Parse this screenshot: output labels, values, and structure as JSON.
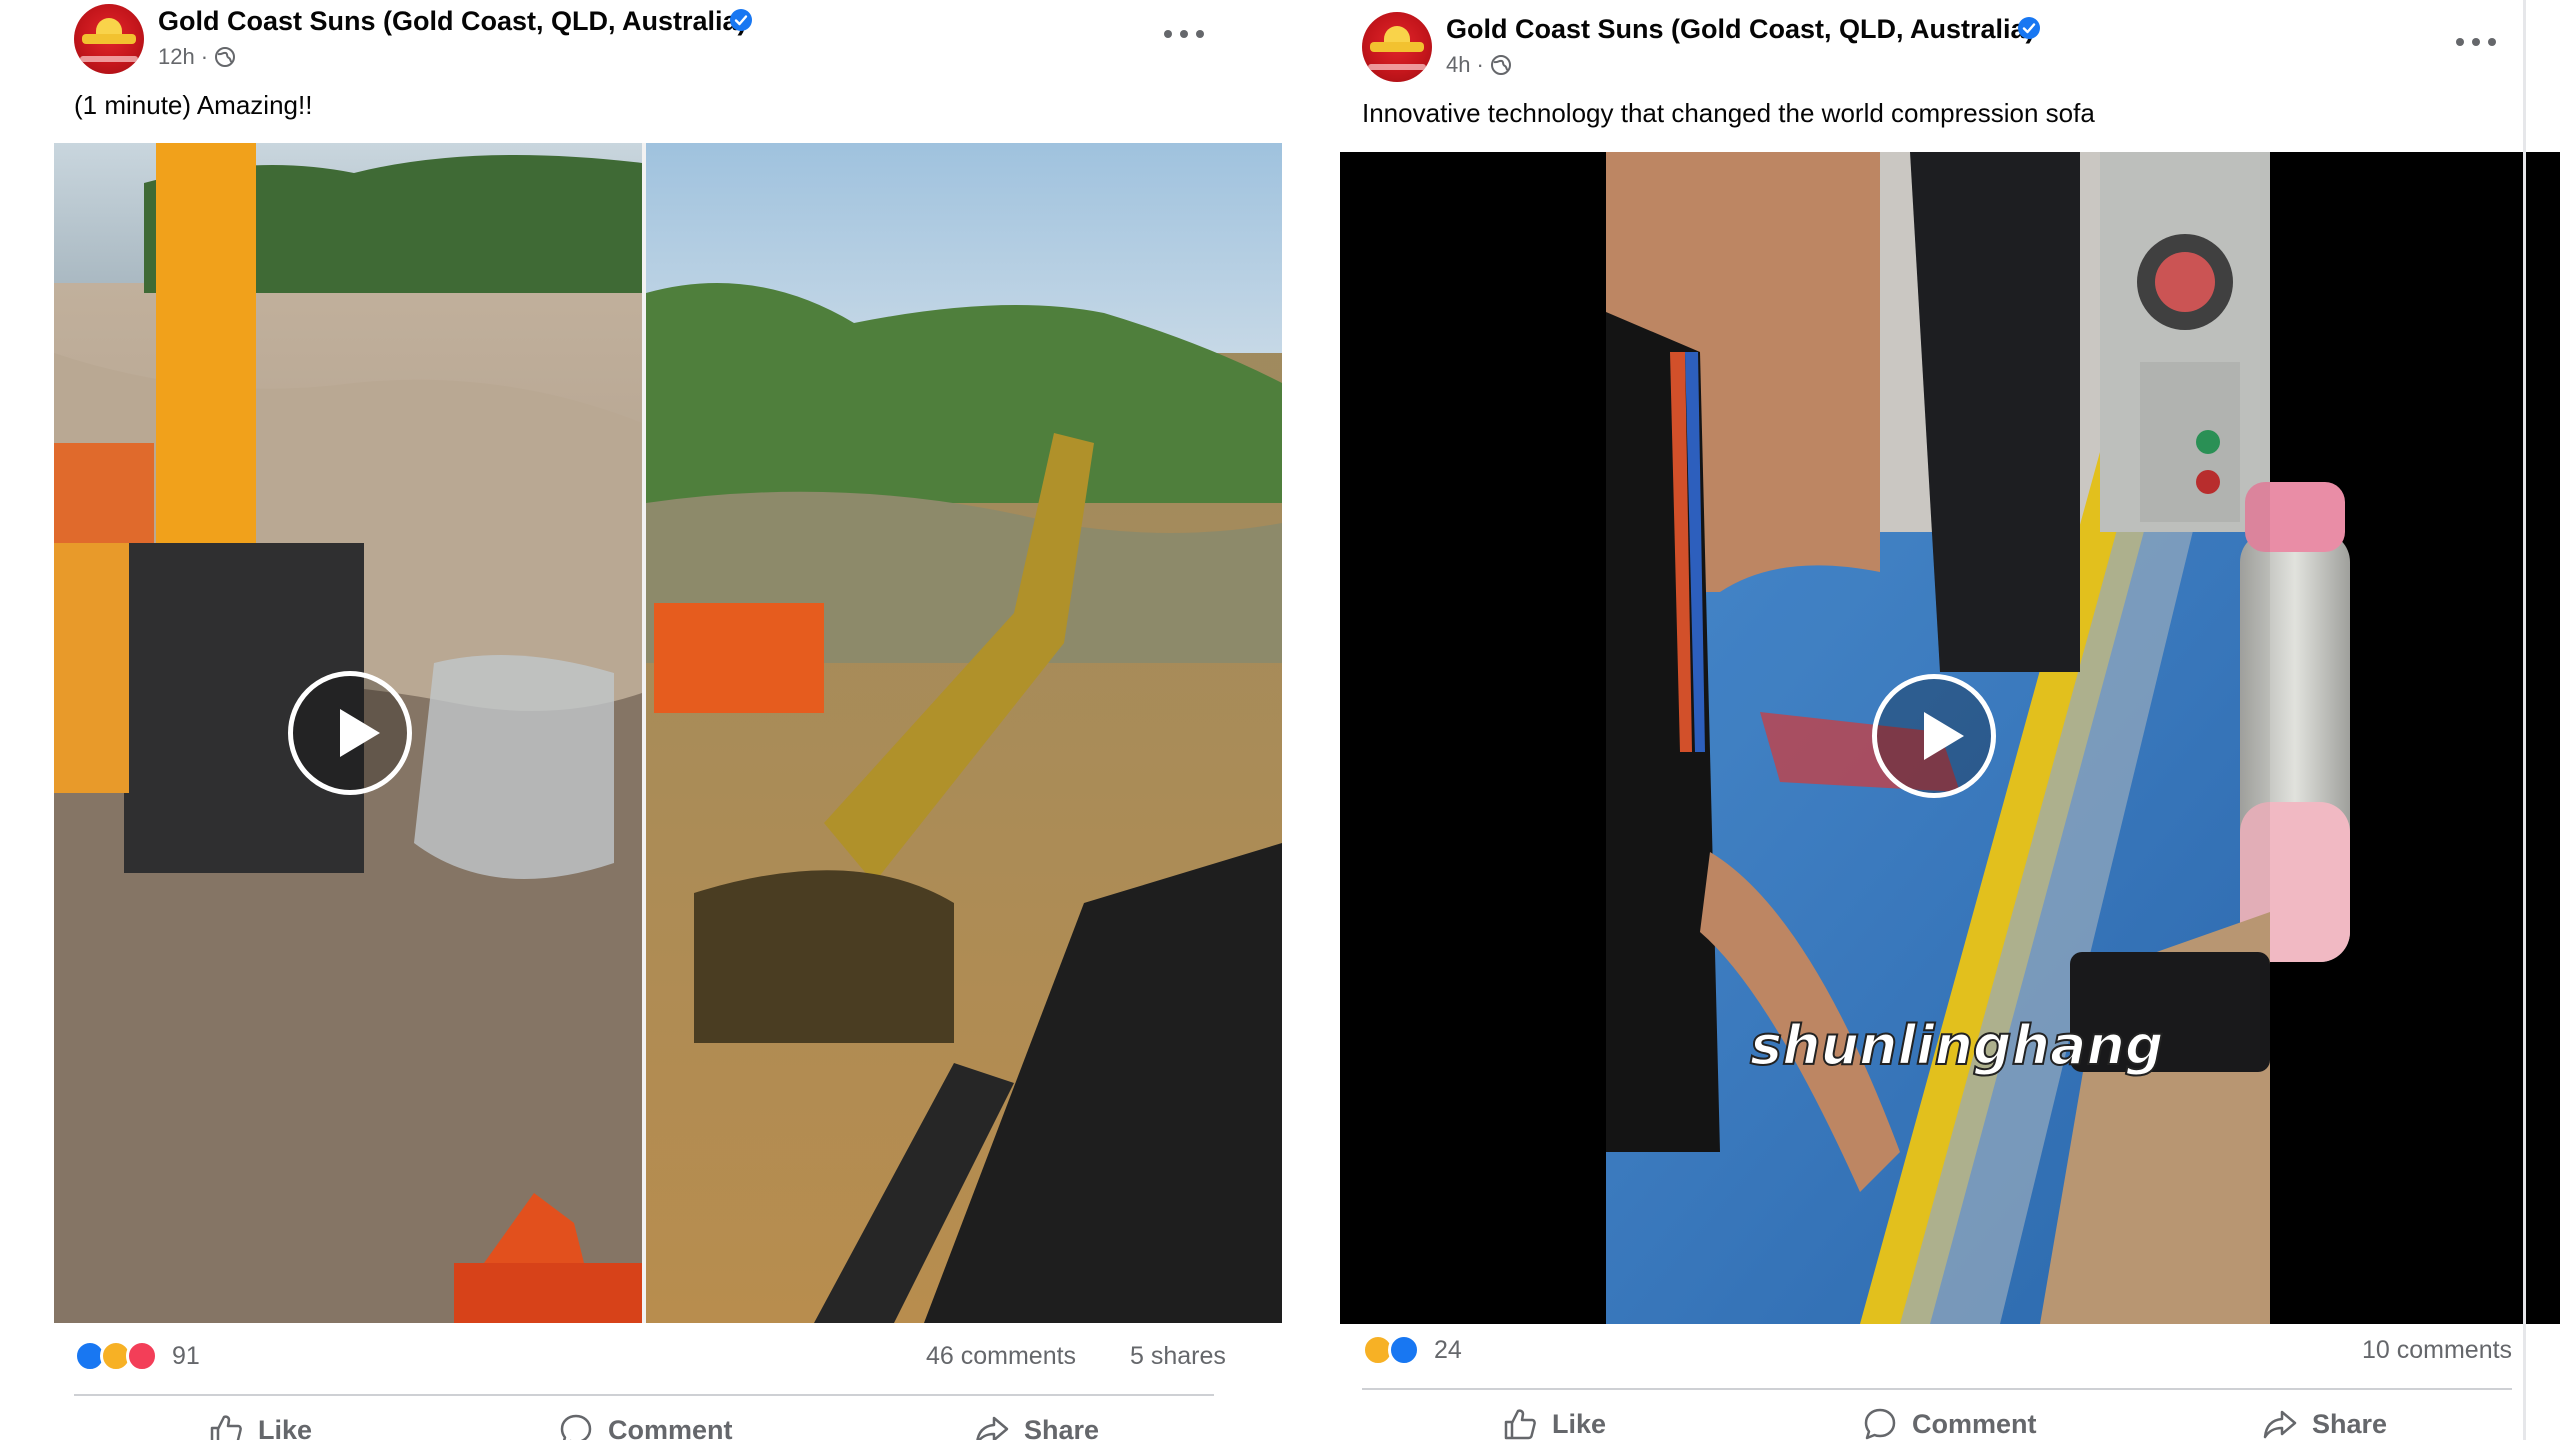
{
  "posts": [
    {
      "page_name": "Gold Coast Suns (Gold Coast, QLD, Australia)",
      "time": "12h",
      "caption": "(1 minute) Amazing!!",
      "reaction_count": "91",
      "comments": "46 comments",
      "shares": "5 shares",
      "actions": {
        "like": "Like",
        "comment": "Comment",
        "share": "Share"
      }
    },
    {
      "page_name": "Gold Coast Suns (Gold Coast, QLD, Australia)",
      "time": "4h",
      "caption": "Innovative technology that changed the world compression sofa",
      "video_overlay_text": "shunlinghang",
      "reaction_count": "24",
      "comments": "10 comments",
      "actions": {
        "like": "Like",
        "comment": "Comment",
        "share": "Share"
      }
    }
  ],
  "colors": {
    "text": "#050505",
    "secondary": "#65676b",
    "verified": "#1877f2",
    "like": "#1877f2",
    "haha": "#f7b125",
    "love": "#f33e58",
    "divider": "#ced0d4"
  }
}
